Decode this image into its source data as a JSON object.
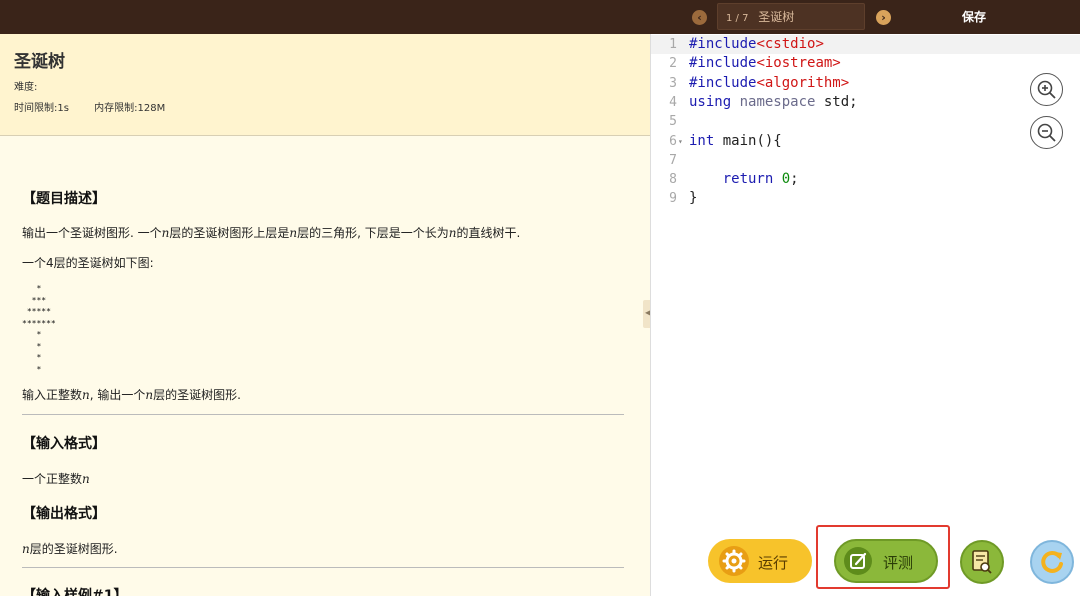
{
  "topbar": {
    "problem_index": "1 / 7",
    "problem_name": "圣诞树",
    "save_label": "保存"
  },
  "problem": {
    "title": "圣诞树",
    "difficulty_label": "难度:",
    "time_limit": "时间限制:1s",
    "memory_limit": "内存限制:128M",
    "sections": {
      "description_heading": "【题目描述】",
      "description_line1_a": "输出一个圣诞树图形. 一个",
      "description_line1_var1": "n",
      "description_line1_b": "层的圣诞树图形上层是",
      "description_line1_var2": "n",
      "description_line1_c": "层的三角形, 下层是一个长为",
      "description_line1_var3": "n",
      "description_line1_d": "的直线树干.",
      "description_line2": "一个4层的圣诞树如下图:",
      "tree_art": "   *\n  ***\n *****\n*******\n   *\n   *\n   *\n   *",
      "description_line3_a": "输入正整数",
      "description_line3_var1": "n",
      "description_line3_b": ", 输出一个",
      "description_line3_var2": "n",
      "description_line3_c": "层的圣诞树图形.",
      "input_heading": "【输入格式】",
      "input_text_a": "一个正整数",
      "input_text_var": "n",
      "output_heading": "【输出格式】",
      "output_text_var": "n",
      "output_text_b": "层的圣诞树图形.",
      "sample_heading": "【输入样例#1】"
    }
  },
  "editor": {
    "lines": [
      {
        "n": "1",
        "parts": [
          [
            "kw",
            "#include"
          ],
          [
            "hdr",
            "<cstdio>"
          ]
        ]
      },
      {
        "n": "2",
        "parts": [
          [
            "kw",
            "#include"
          ],
          [
            "hdr",
            "<iostream>"
          ]
        ]
      },
      {
        "n": "3",
        "parts": [
          [
            "kw",
            "#include"
          ],
          [
            "hdr",
            "<algorithm>"
          ]
        ]
      },
      {
        "n": "4",
        "parts": [
          [
            "kw",
            "using"
          ],
          [
            "plain",
            " "
          ],
          [
            "dim",
            "namespace"
          ],
          [
            "plain",
            " std;"
          ]
        ]
      },
      {
        "n": "5",
        "parts": []
      },
      {
        "n": "6",
        "parts": [
          [
            "kw",
            "int"
          ],
          [
            "plain",
            " main(){"
          ]
        ]
      },
      {
        "n": "7",
        "parts": []
      },
      {
        "n": "8",
        "parts": [
          [
            "plain",
            "    "
          ],
          [
            "kw",
            "return"
          ],
          [
            "plain",
            " "
          ],
          [
            "num",
            "0"
          ],
          [
            "plain",
            ";"
          ]
        ]
      },
      {
        "n": "9",
        "parts": [
          [
            "plain",
            "}"
          ]
        ]
      }
    ]
  },
  "actions": {
    "run_label": "运行",
    "judge_label": "评测"
  },
  "icons": {
    "prev": "chevron-left-icon",
    "next": "chevron-right-icon",
    "zoom_in": "zoom-in-icon",
    "zoom_out": "zoom-out-icon",
    "run": "gear-icon",
    "judge": "edit-icon",
    "inspect": "document-search-icon",
    "reset": "refresh-icon"
  },
  "colors": {
    "topbar": "#3a2419",
    "run_button": "#f7c32b",
    "judge_button": "#8bb83a",
    "highlight": "#e23a2f"
  }
}
